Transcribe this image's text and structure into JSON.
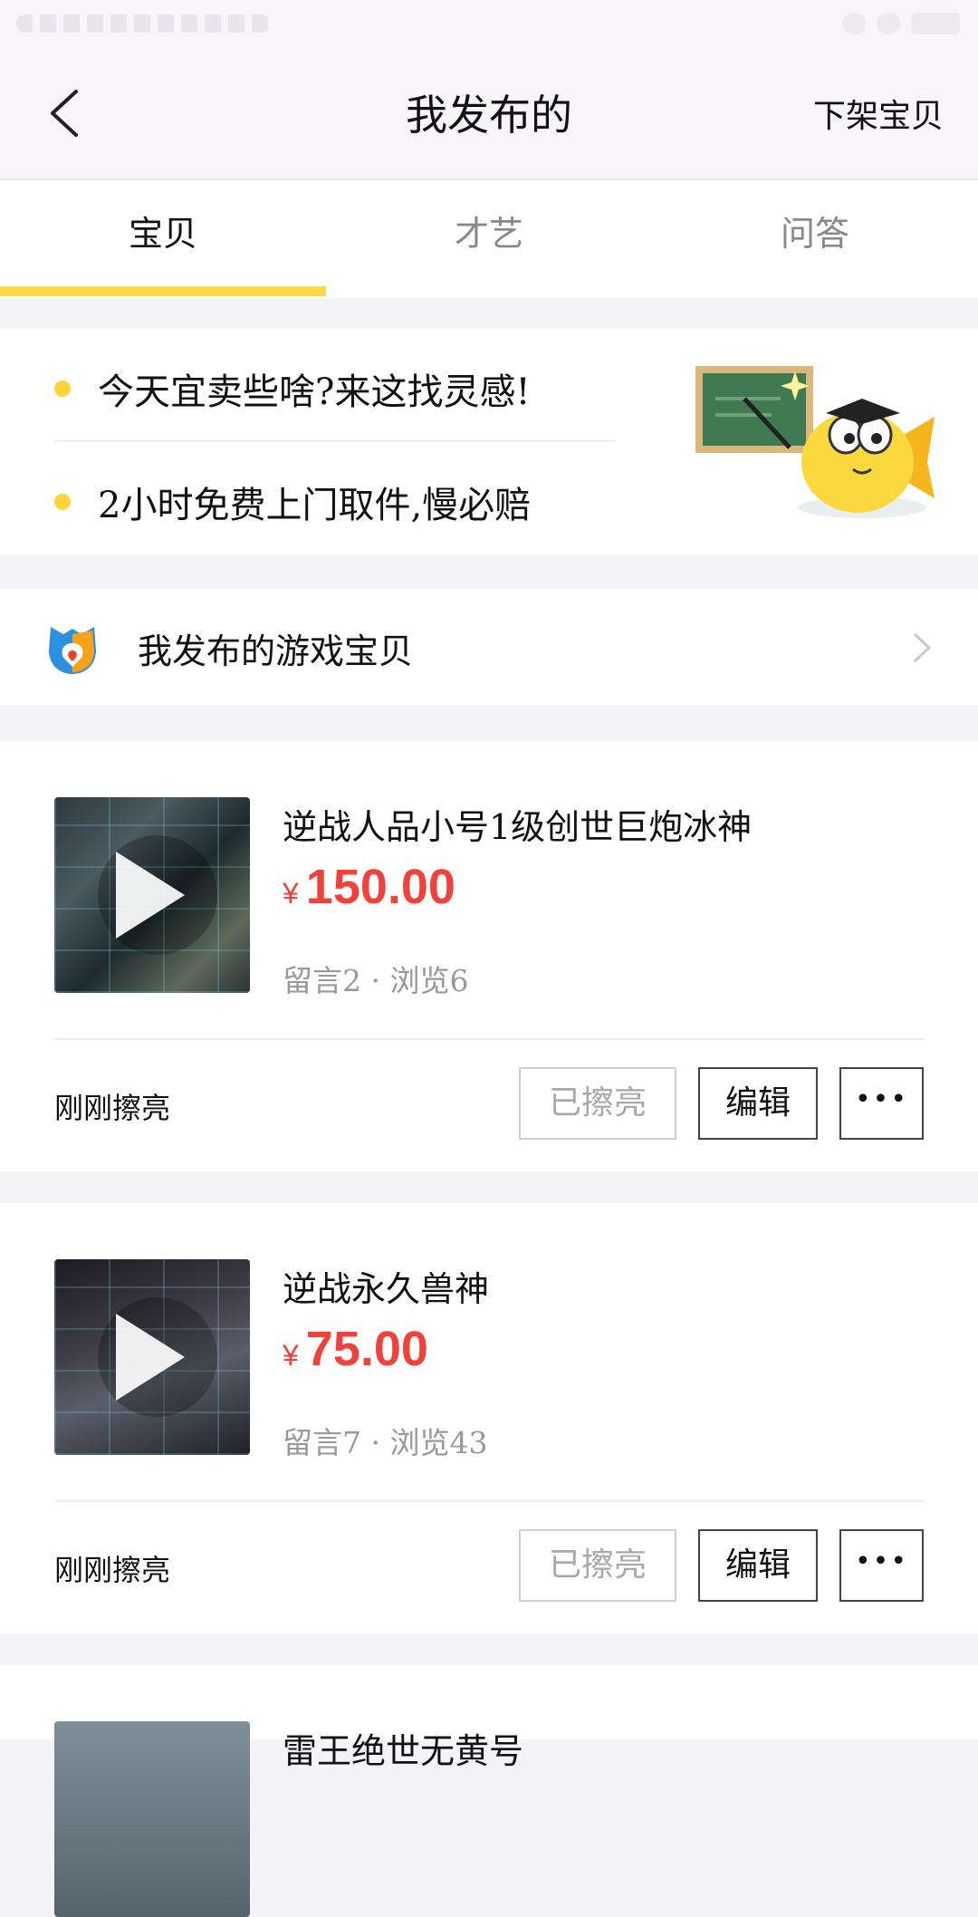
{
  "header": {
    "title": "我发布的",
    "right_action": "下架宝贝"
  },
  "tabs": [
    {
      "label": "宝贝",
      "active": true
    },
    {
      "label": "才艺",
      "active": false
    },
    {
      "label": "问答",
      "active": false
    }
  ],
  "banner": {
    "items": [
      {
        "text": "今天宜卖些啥?来这找灵感!"
      },
      {
        "text": "2小时免费上门取件,慢必赔"
      }
    ]
  },
  "game_row": {
    "label": "我发布的游戏宝贝"
  },
  "items": [
    {
      "title": "逆战人品小号1级创世巨炮冰神",
      "currency": "¥",
      "price": "150.00",
      "stats": "留言2 · 浏览6",
      "status": "刚刚擦亮",
      "polish_label": "已擦亮",
      "edit_label": "编辑",
      "more_label": "•••"
    },
    {
      "title": "逆战永久兽神",
      "currency": "¥",
      "price": "75.00",
      "stats": "留言7 · 浏览43",
      "status": "刚刚擦亮",
      "polish_label": "已擦亮",
      "edit_label": "编辑",
      "more_label": "•••"
    },
    {
      "title": "雷王绝世无黄号"
    }
  ],
  "colors": {
    "accent": "#ffda44",
    "price": "#f0413a",
    "background": "#f3f3f8"
  }
}
